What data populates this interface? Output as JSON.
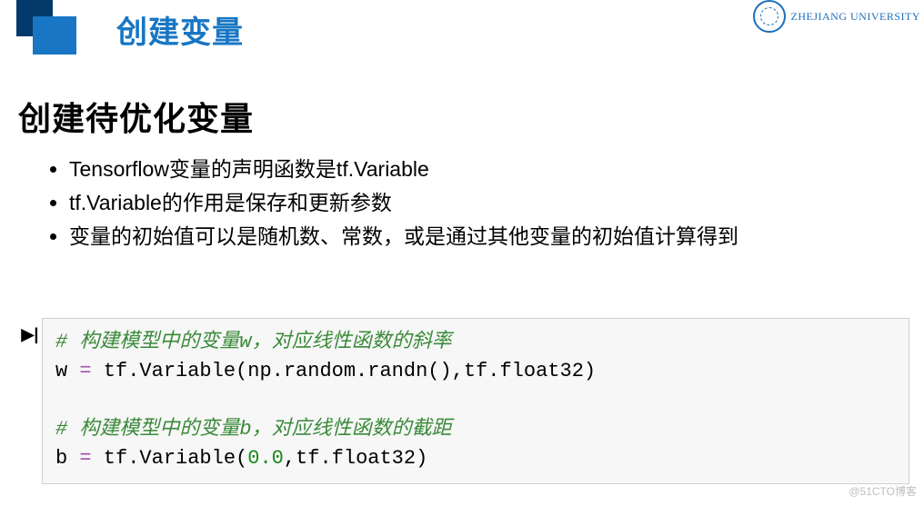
{
  "slide_title": "创建变量",
  "university": "ZHEJIANG UNIVERSITY",
  "section_title": "创建待优化变量",
  "bullets": [
    "Tensorflow变量的声明函数是tf.Variable",
    "tf.Variable的作用是保存和更新参数",
    "变量的初始值可以是随机数、常数，或是通过其他变量的初始值计算得到"
  ],
  "code": {
    "c1": "# 构建模型中的变量w，对应线性函数的斜率",
    "l1a": "w ",
    "l1op": "=",
    "l1b": " tf.Variable(np.random.randn(),tf.float32)",
    "c2": "# 构建模型中的变量b，对应线性函数的截距",
    "l2a": "b ",
    "l2op": "=",
    "l2b1": " tf.Variable(",
    "l2num": "0.0",
    "l2b2": ",tf.float32)"
  },
  "run_glyph": "▶|",
  "watermark": "@51CTO博客"
}
